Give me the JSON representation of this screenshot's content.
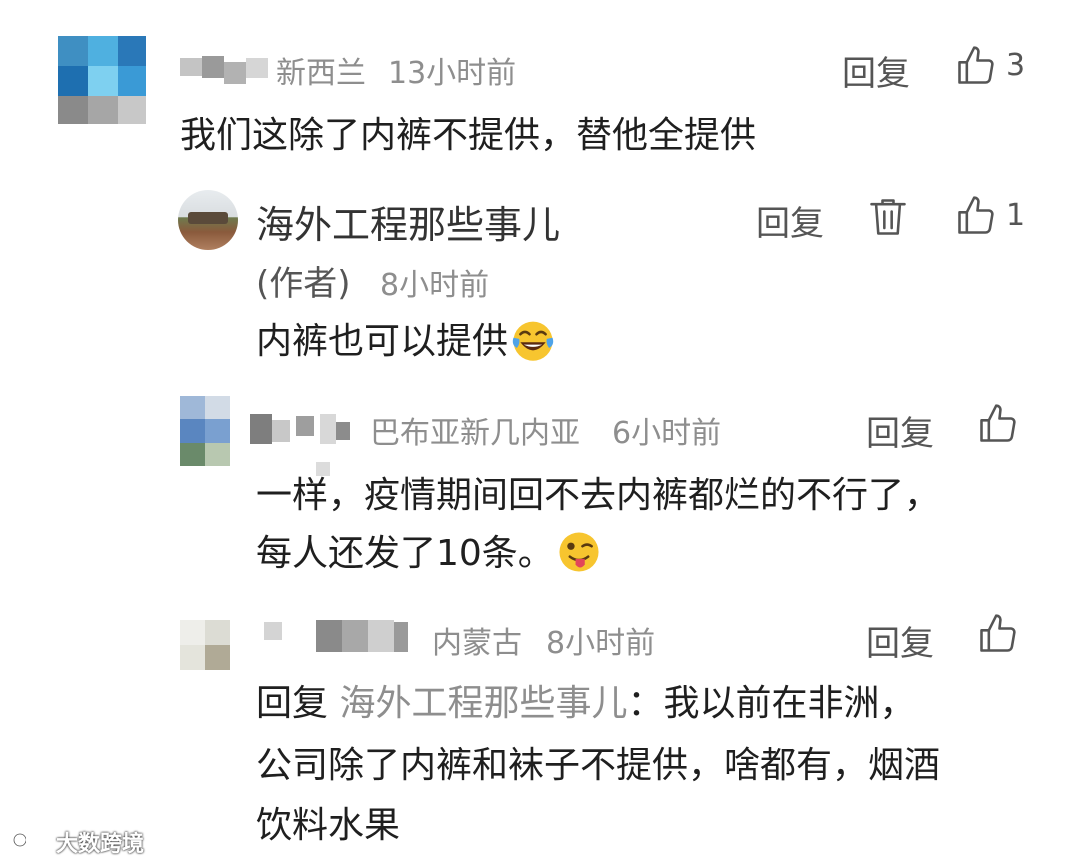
{
  "comments": [
    {
      "location": "新西兰",
      "time": "13小时前",
      "reply_label": "回复",
      "likes": "3",
      "text": "我们这除了内裤不提供，替他全提供"
    },
    {
      "author": "海外工程那些事儿",
      "author_tag": "(作者)",
      "time": "8小时前",
      "reply_label": "回复",
      "likes": "1",
      "text": "内裤也可以提供"
    },
    {
      "location": "巴布亚新几内亚",
      "time": "6小时前",
      "reply_label": "回复",
      "text_line1": "一样，疫情期间回不去内裤都烂的不行了，",
      "text_line2": "每人还发了10条。"
    },
    {
      "location": "内蒙古",
      "time": "8小时前",
      "reply_label": "回复",
      "reply_prefix": "回复",
      "mention": "海外工程那些事儿",
      "line1_rest": "：我以前在非洲，",
      "text_line2": "公司除了内裤和袜子不提供，啥都有，烟酒",
      "text_line3": "饮料水果"
    }
  ],
  "watermark": "大数跨境",
  "icons": {
    "like": "thumbs-up-icon",
    "delete": "trash-icon",
    "emoji_laugh": "tears-of-joy-emoji",
    "emoji_wink": "winking-tongue-emoji"
  },
  "colors": {
    "meta": "#8e8e8e",
    "body": "#1f1f1f"
  }
}
